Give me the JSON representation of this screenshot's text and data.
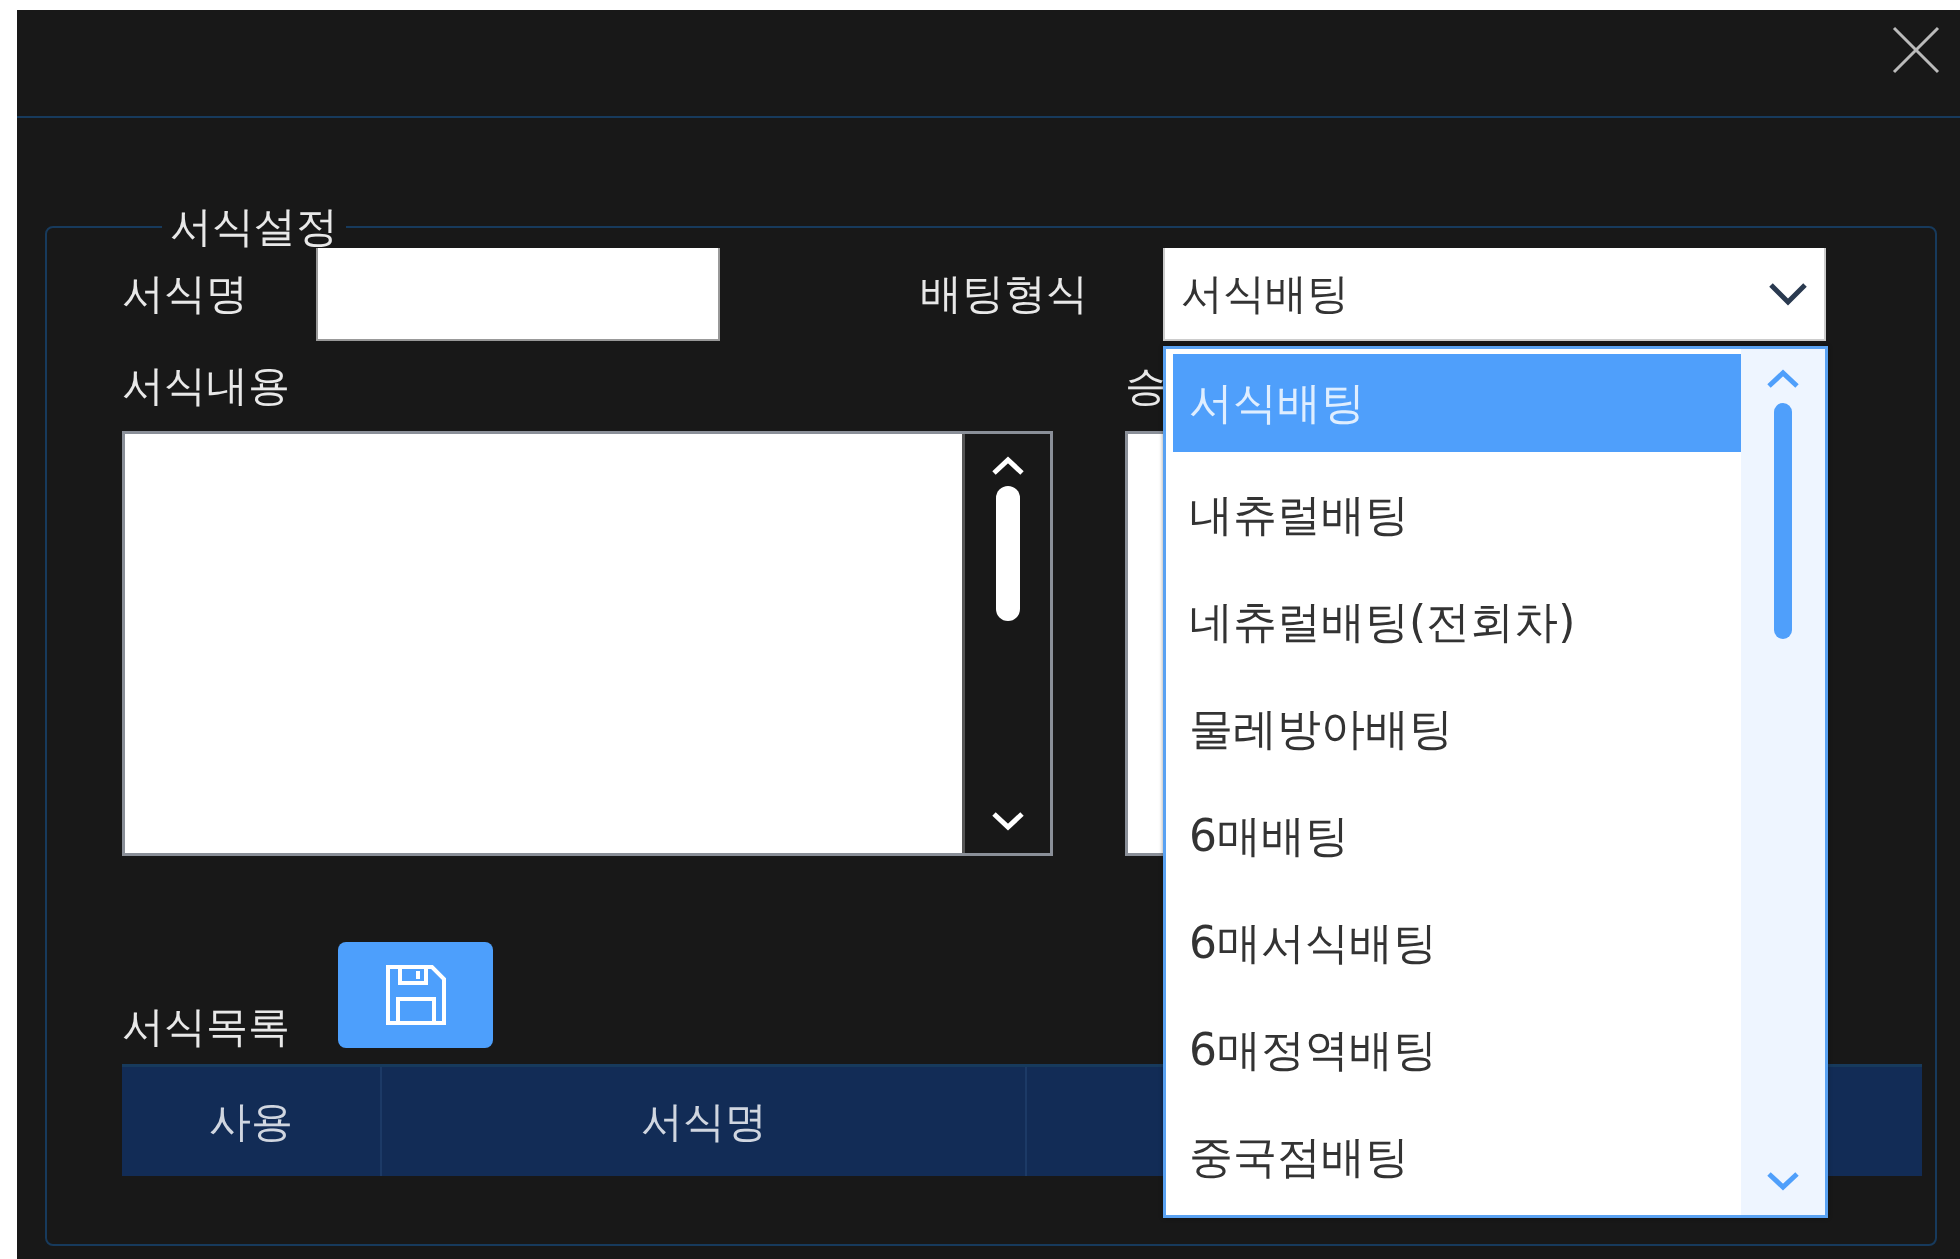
{
  "form_section": {
    "legend": "서식설정",
    "name_field": {
      "label": "서식명"
    },
    "bet_type": {
      "label": "배팅형식",
      "value": "서식배팅",
      "expanded": true,
      "options": [
        {
          "label": "서식배팅",
          "selected": true
        },
        {
          "label": "내츄럴배팅",
          "selected": false
        },
        {
          "label": "네츄럴배팅(전회차)",
          "selected": false
        },
        {
          "label": "물레방아배팅",
          "selected": false
        },
        {
          "label": "6매배팅",
          "selected": false
        },
        {
          "label": "6매서식배팅",
          "selected": false
        },
        {
          "label": "6매정역배팅",
          "selected": false
        },
        {
          "label": "중국점배팅",
          "selected": false
        }
      ]
    },
    "content_field": {
      "label": "서식내용"
    },
    "second_field": {
      "label": "승"
    },
    "list_label": "서식목록",
    "table": {
      "columns": [
        "사용",
        "서식명"
      ]
    }
  }
}
